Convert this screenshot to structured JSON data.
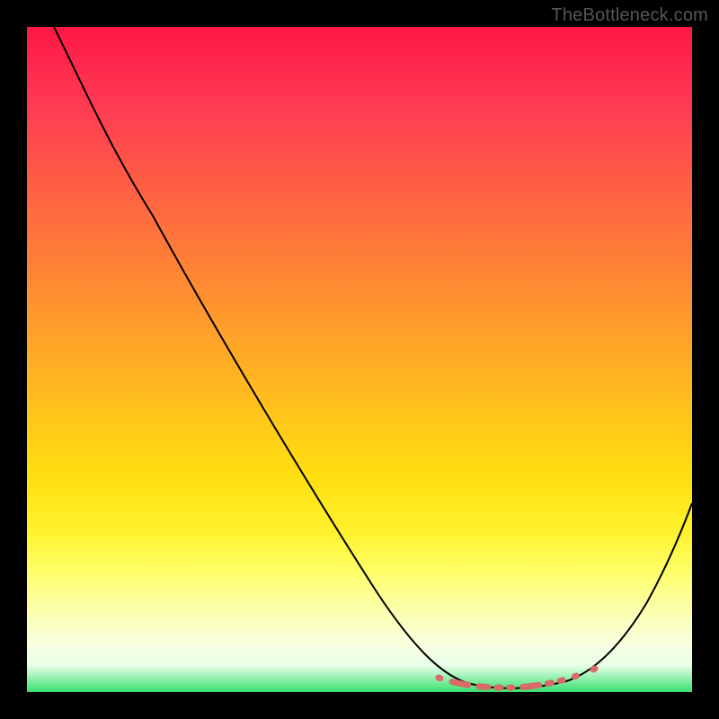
{
  "watermark": "TheBottleneck.com",
  "colors": {
    "background": "#000000",
    "curve": "#000000",
    "dots": "#d96a66",
    "gradient_top": "#ff1744",
    "gradient_bottom": "#38e070"
  },
  "chart_data": {
    "type": "line",
    "title": "",
    "xlabel": "",
    "ylabel": "",
    "xlim": [
      0,
      100
    ],
    "ylim": [
      0,
      100
    ],
    "series": [
      {
        "name": "bottleneck-curve",
        "x": [
          4,
          10,
          20,
          30,
          40,
          50,
          58,
          63,
          67,
          72,
          77,
          82,
          86,
          90,
          94,
          100
        ],
        "y": [
          100,
          90,
          74,
          58,
          42,
          26,
          13,
          6,
          2,
          0,
          0,
          1,
          4,
          9,
          16,
          28
        ]
      }
    ],
    "highlight_band": {
      "name": "optimal-range-dots",
      "x_start": 63,
      "x_end": 86,
      "y_approx": 1
    },
    "legend": null,
    "grid": false
  }
}
